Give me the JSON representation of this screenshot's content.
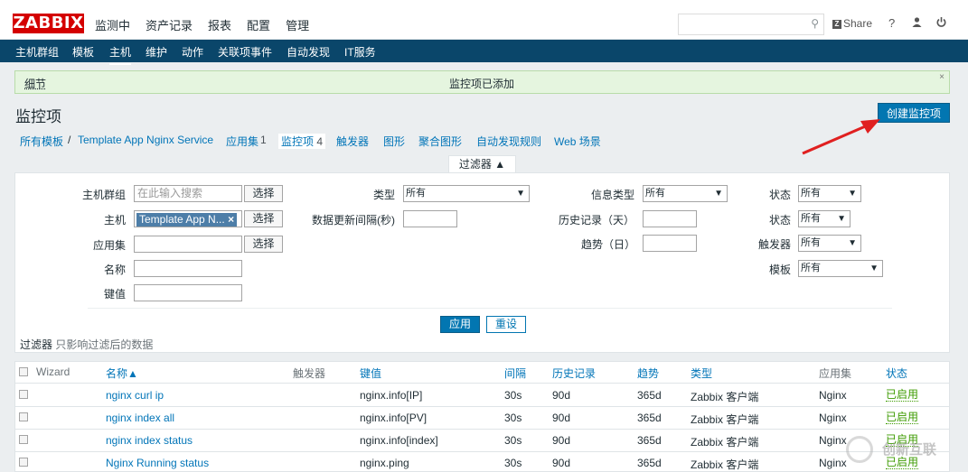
{
  "app": {
    "logo": "ZABBIX"
  },
  "topmenu": [
    "监测中",
    "资产记录",
    "报表",
    "配置",
    "管理"
  ],
  "topbar": {
    "share": "Share",
    "help": "?",
    "user_icon": "user-icon",
    "logout_icon": "power-icon"
  },
  "subnav": [
    "主机群组",
    "模板",
    "主机",
    "维护",
    "动作",
    "关联项事件",
    "自动发现",
    "IT服务"
  ],
  "message": {
    "detail": "细节",
    "text": "监控项已添加",
    "close": "×"
  },
  "page": {
    "title": "监控项",
    "create_button": "创建监控项"
  },
  "breadcrumb": {
    "all_templates": "所有模板",
    "sep": "/",
    "template": "Template App Nginx Service",
    "apps": "应用集",
    "apps_count": "1",
    "items": "监控项",
    "items_count": "4",
    "triggers": "触发器",
    "graphs": "图形",
    "screens": "聚合图形",
    "discovery": "自动发现规则",
    "web": "Web 场景"
  },
  "filter": {
    "tab": "过滤器 ▲",
    "host_group_label": "主机群组",
    "host_group_placeholder": "在此输入搜索",
    "select": "选择",
    "host_label": "主机",
    "host_chip": "Template App N...",
    "chip_close": "×",
    "app_label": "应用集",
    "name_label": "名称",
    "key_label": "键值",
    "type_label": "类型",
    "type_value": "所有",
    "interval_label": "数据更新间隔(秒)",
    "info_type_label": "信息类型",
    "info_type_value": "所有",
    "history_label": "历史记录（天）",
    "trends_label": "趋势（日）",
    "state_label": "状态",
    "state_value": "所有",
    "status_label": "状态",
    "status_value": "所有",
    "triggers_label": "触发器",
    "triggers_value": "所有",
    "template_label": "模板",
    "template_value": "所有",
    "apply": "应用",
    "reset": "重设",
    "note_title": "过滤器",
    "note_text": "只影响过滤后的数据"
  },
  "table": {
    "headers": {
      "wizard": "Wizard",
      "name": "名称▲",
      "triggers": "触发器",
      "key": "键值",
      "interval": "间隔",
      "history": "历史记录",
      "trends": "趋势",
      "type": "类型",
      "applications": "应用集",
      "status": "状态"
    },
    "rows": [
      {
        "name": "nginx curl ip",
        "key": "nginx.info[IP]",
        "interval": "30s",
        "history": "90d",
        "trends": "365d",
        "type": "Zabbix 客户端",
        "app": "Nginx",
        "status": "已启用"
      },
      {
        "name": "nginx index all",
        "key": "nginx.info[PV]",
        "interval": "30s",
        "history": "90d",
        "trends": "365d",
        "type": "Zabbix 客户端",
        "app": "Nginx",
        "status": "已启用"
      },
      {
        "name": "nginx index status",
        "key": "nginx.info[index]",
        "interval": "30s",
        "history": "90d",
        "trends": "365d",
        "type": "Zabbix 客户端",
        "app": "Nginx",
        "status": "已启用"
      },
      {
        "name": "Nginx Running status",
        "key": "nginx.ping",
        "interval": "30s",
        "history": "90d",
        "trends": "365d",
        "type": "Zabbix 客户端",
        "app": "Nginx",
        "status": "已启用"
      }
    ]
  },
  "watermark": {
    "text": "创新互联"
  },
  "colors": {
    "brand": "#d40000",
    "nav": "#0a466a",
    "link": "#0275b8",
    "primary_button": "#0276b1",
    "enabled": "#3d9b00",
    "arrow": "#e02020"
  }
}
